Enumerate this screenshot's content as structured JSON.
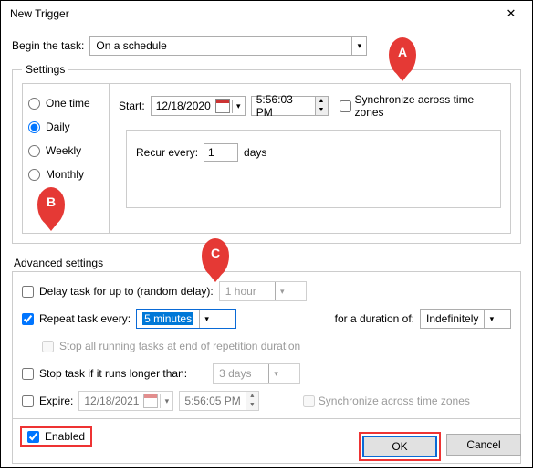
{
  "window": {
    "title": "New Trigger",
    "close": "✕"
  },
  "begin": {
    "label": "Begin the task:",
    "value": "On a schedule"
  },
  "settings": {
    "legend": "Settings",
    "freq": {
      "onetime": "One time",
      "daily": "Daily",
      "weekly": "Weekly",
      "monthly": "Monthly",
      "selected": "daily"
    },
    "start_label": "Start:",
    "start_date": "12/18/2020",
    "start_time": "5:56:03 PM",
    "sync_label": "Synchronize across time zones",
    "recur_label": "Recur every:",
    "recur_value": "1",
    "recur_unit": "days"
  },
  "advanced": {
    "legend": "Advanced settings",
    "delay_label": "Delay task for up to (random delay):",
    "delay_value": "1 hour",
    "repeat_label": "Repeat task every:",
    "repeat_value": "5 minutes",
    "duration_label": "for a duration of:",
    "duration_value": "Indefinitely",
    "stop_all_label": "Stop all running tasks at end of repetition duration",
    "stop_if_label": "Stop task if it runs longer than:",
    "stop_if_value": "3 days",
    "expire_label": "Expire:",
    "expire_date": "12/18/2021",
    "expire_time": "5:56:05 PM",
    "sync_label": "Synchronize across time zones",
    "enabled_label": "Enabled"
  },
  "buttons": {
    "ok": "OK",
    "cancel": "Cancel"
  },
  "markers": {
    "a": "A",
    "b": "B",
    "c": "C"
  }
}
